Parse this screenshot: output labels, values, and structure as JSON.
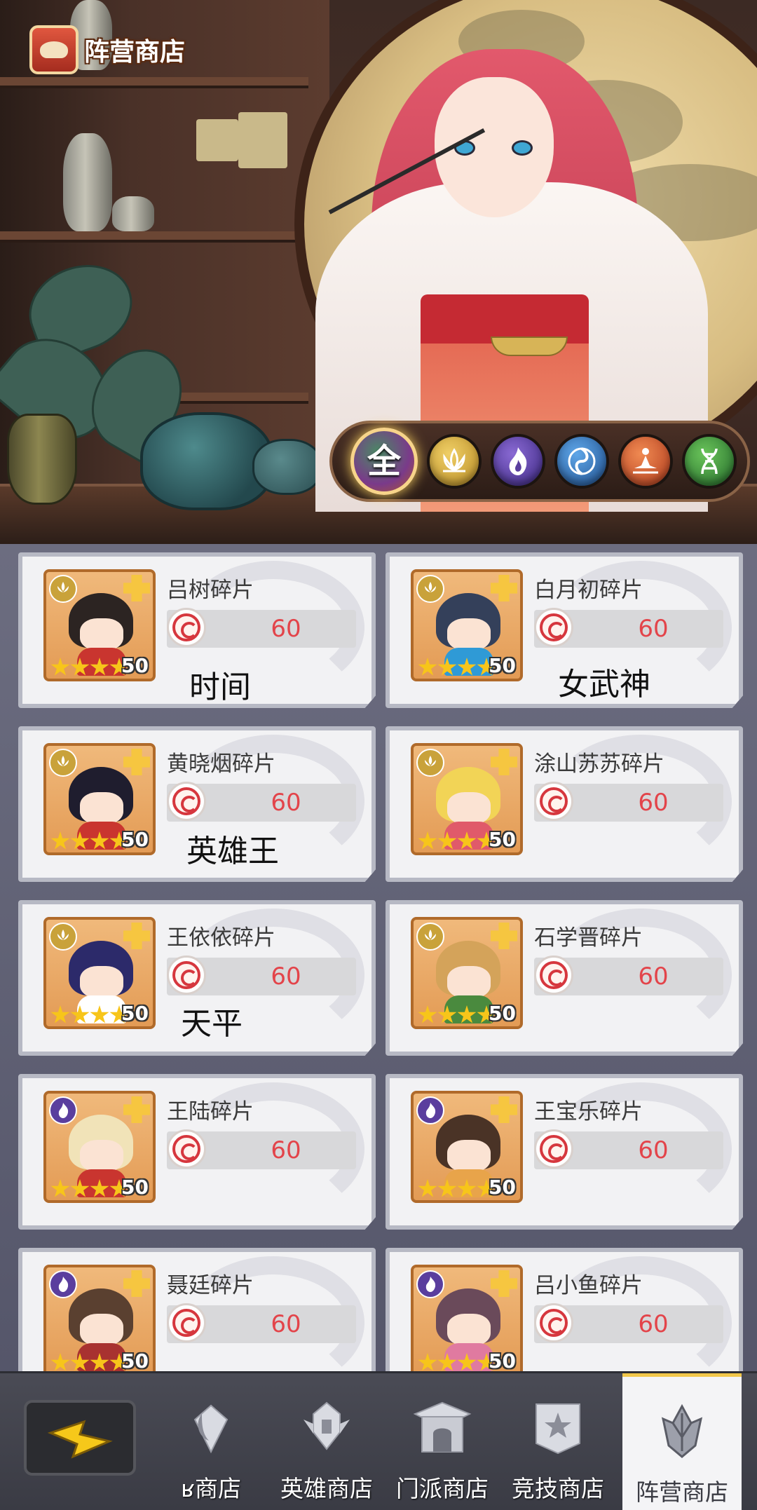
{
  "header": {
    "title": "阵营商店"
  },
  "filters": {
    "all_label": "全",
    "items": [
      {
        "icon": "lotus-icon",
        "color": "#c9a23a"
      },
      {
        "icon": "purple-flame-icon",
        "color": "#5a3e9e"
      },
      {
        "icon": "swirl-icon",
        "color": "#2f6fb4"
      },
      {
        "icon": "meditation-icon",
        "color": "#d55a2e"
      },
      {
        "icon": "dna-icon",
        "color": "#3d8a3a"
      }
    ]
  },
  "shop": {
    "items": [
      {
        "name": "吕树碎片",
        "price": "60",
        "count": "50",
        "stars": 4,
        "faction": "lotus",
        "hair": "#2c2422",
        "body": "#c9352f"
      },
      {
        "name": "白月初碎片",
        "price": "60",
        "count": "50",
        "stars": 4,
        "faction": "lotus",
        "hair": "#34405a",
        "body": "#2f9ad6"
      },
      {
        "name": "黄晓烟碎片",
        "price": "60",
        "count": "50",
        "stars": 4,
        "faction": "lotus",
        "hair": "#1f1d2e",
        "body": "#c9352f"
      },
      {
        "name": "涂山苏苏碎片",
        "price": "60",
        "count": "50",
        "stars": 4,
        "faction": "lotus",
        "hair": "#f2d456",
        "body": "#e05a6a"
      },
      {
        "name": "王依依碎片",
        "price": "60",
        "count": "50",
        "stars": 4,
        "faction": "lotus",
        "hair": "#2c2a6a",
        "body": "#ffffff"
      },
      {
        "name": "石学晋碎片",
        "price": "60",
        "count": "50",
        "stars": 4,
        "faction": "lotus",
        "hair": "#d4a35a",
        "body": "#4a8a3e"
      },
      {
        "name": "王陆碎片",
        "price": "60",
        "count": "50",
        "stars": 4,
        "faction": "flame",
        "hair": "#f1e3b8",
        "body": "#c9352f"
      },
      {
        "name": "王宝乐碎片",
        "price": "60",
        "count": "50",
        "stars": 4,
        "faction": "flame",
        "hair": "#4a3326",
        "body": "#e8a44a"
      },
      {
        "name": "聂廷碎片",
        "price": "60",
        "count": "50",
        "stars": 4,
        "faction": "flame",
        "hair": "#5a4030",
        "body": "#a83230"
      },
      {
        "name": "吕小鱼碎片",
        "price": "60",
        "count": "50",
        "stars": 4,
        "faction": "flame",
        "hair": "#6a4a5a",
        "body": "#e07aa0"
      }
    ],
    "overlay_labels": [
      "时间",
      "女武神",
      "英雄王",
      "天平"
    ]
  },
  "nav": {
    "tabs": [
      {
        "label": "ʁ商店",
        "icon": "crystal-moon-icon"
      },
      {
        "label": "英雄商店",
        "icon": "hero-helmet-icon"
      },
      {
        "label": "门派商店",
        "icon": "temple-gate-icon"
      },
      {
        "label": "竞技商店",
        "icon": "arena-banner-icon"
      },
      {
        "label": "阵营商店",
        "icon": "faction-crystal-icon"
      }
    ],
    "active_index": 4
  },
  "colors": {
    "accent_gold": "#f2c74a",
    "price_red": "#e3444a"
  }
}
